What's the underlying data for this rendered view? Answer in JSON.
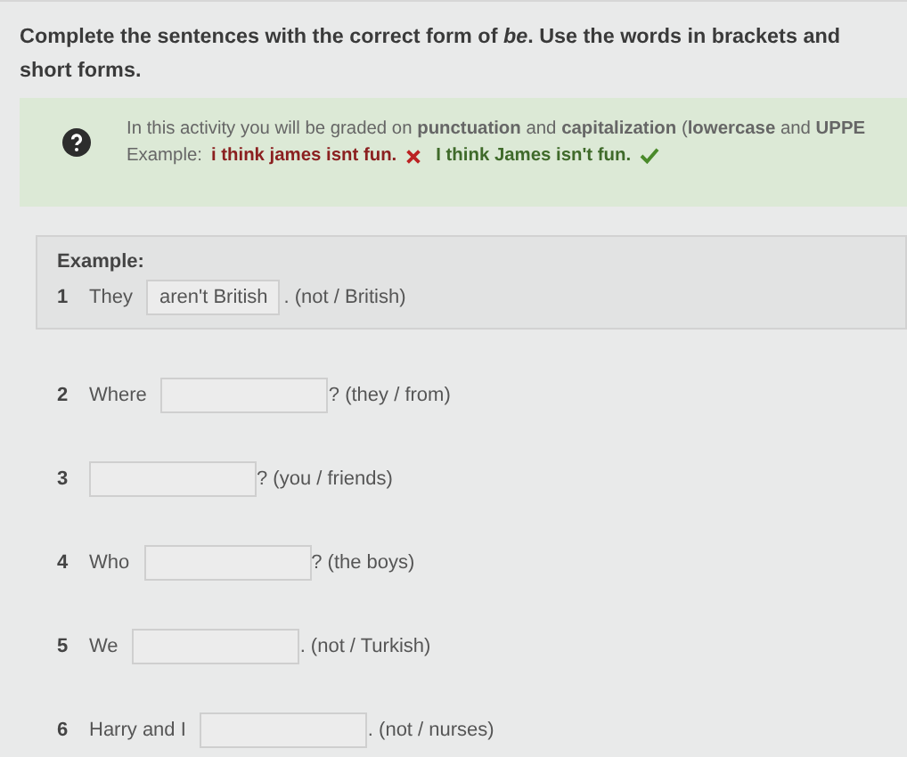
{
  "instruction": "Complete the sentences with the correct form of *be*. Use the words in brackets and short forms.",
  "note": {
    "text": "In this activity you will be graded on **punctuation** and **capitalization** (**lowercase** and **UPPE**",
    "example_label": "Example:",
    "wrong": "i think james isnt fun.",
    "right": "I think James isn't fun."
  },
  "example": {
    "heading": "Example:",
    "number": "1",
    "before": "They",
    "value": "aren't British",
    "after": ". (not / British)"
  },
  "items": [
    {
      "number": "2",
      "before": "Where",
      "after": "? (they / from)"
    },
    {
      "number": "3",
      "after": "? (you / friends)"
    },
    {
      "number": "4",
      "before": "Who",
      "after": "? (the boys)"
    },
    {
      "number": "5",
      "before": "We",
      "after": ". (not / Turkish)"
    },
    {
      "number": "6",
      "before": "Harry and I",
      "after": ". (not / nurses)"
    }
  ]
}
